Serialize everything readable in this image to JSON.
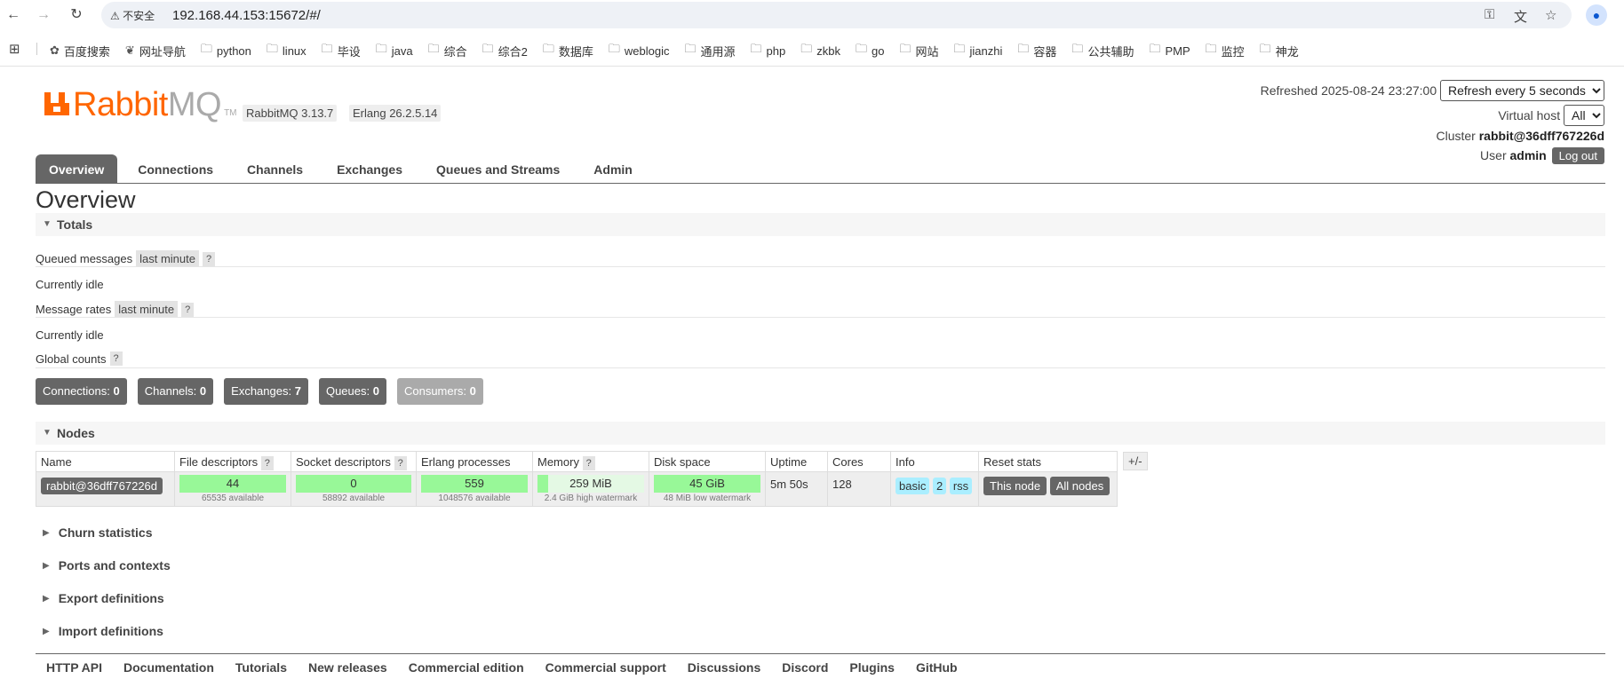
{
  "browser": {
    "security_label": "不安全",
    "url": "192.168.44.153:15672/#/",
    "bookmarks": [
      "百度搜索",
      "网址导航",
      "python",
      "linux",
      "毕设",
      "java",
      "综合",
      "综合2",
      "数据库",
      "weblogic",
      "通用源",
      "php",
      "zkbk",
      "go",
      "网站",
      "jianzhi",
      "容器",
      "公共辅助",
      "PMP",
      "监控",
      "神龙"
    ]
  },
  "header": {
    "logo_main": "Rabbit",
    "logo_suffix": "MQ",
    "logo_tm": "TM",
    "version_rabbitmq": "RabbitMQ 3.13.7",
    "version_erlang": "Erlang 26.2.5.14",
    "refreshed_label": "Refreshed 2025-08-24 23:27:00",
    "refresh_option": "Refresh every 5 seconds",
    "vhost_label": "Virtual host",
    "vhost_option": "All",
    "cluster_label": "Cluster",
    "cluster_name": "rabbit@36dff767226d",
    "user_label": "User",
    "user_name": "admin",
    "logout_label": "Log out"
  },
  "tabs": [
    "Overview",
    "Connections",
    "Channels",
    "Exchanges",
    "Queues and Streams",
    "Admin"
  ],
  "page_title": "Overview",
  "totals": {
    "section_label": "Totals",
    "queued_label": "Queued messages",
    "queued_period": "last minute",
    "help": "?",
    "queued_status": "Currently idle",
    "rates_label": "Message rates",
    "rates_period": "last minute",
    "rates_status": "Currently idle",
    "global_label": "Global counts",
    "counts": {
      "connections_label": "Connections:",
      "connections": "0",
      "channels_label": "Channels:",
      "channels": "0",
      "exchanges_label": "Exchanges:",
      "exchanges": "7",
      "queues_label": "Queues:",
      "queues": "0",
      "consumers_label": "Consumers:",
      "consumers": "0"
    }
  },
  "nodes": {
    "section_label": "Nodes",
    "columns": [
      "Name",
      "File descriptors",
      "Socket descriptors",
      "Erlang processes",
      "Memory",
      "Disk space",
      "Uptime",
      "Cores",
      "Info",
      "Reset stats"
    ],
    "plusminus": "+/-",
    "row": {
      "name": "rabbit@36dff767226d",
      "fd": "44",
      "fd_sub": "65535 available",
      "sd": "0",
      "sd_sub": "58892 available",
      "ep": "559",
      "ep_sub": "1048576 available",
      "mem": "259 MiB",
      "mem_sub": "2.4 GiB high watermark",
      "mem_fraction": 0.1,
      "disk": "45 GiB",
      "disk_sub": "48 MiB low watermark",
      "uptime": "5m 50s",
      "cores": "128",
      "info_tags": [
        "basic",
        "2",
        "rss"
      ],
      "reset_this": "This node",
      "reset_all": "All nodes"
    }
  },
  "collapsed_sections": [
    "Churn statistics",
    "Ports and contexts",
    "Export definitions",
    "Import definitions"
  ],
  "footer_links": [
    "HTTP API",
    "Documentation",
    "Tutorials",
    "New releases",
    "Commercial edition",
    "Commercial support",
    "Discussions",
    "Discord",
    "Plugins",
    "GitHub"
  ]
}
